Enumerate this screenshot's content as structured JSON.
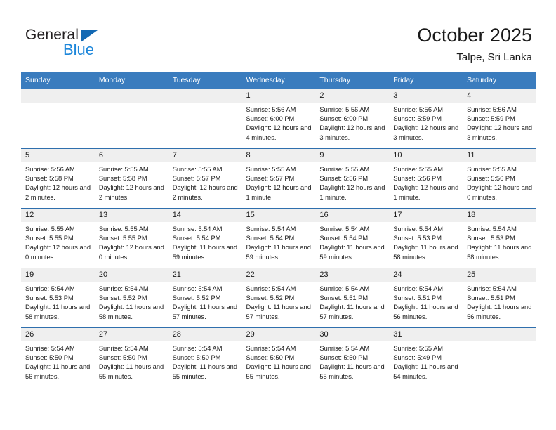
{
  "brand": {
    "name_top": "General",
    "name_bottom": "Blue",
    "accent_color": "#1268b3",
    "accent_color_light": "#1e87da"
  },
  "header": {
    "title": "October 2025",
    "subtitle": "Talpe, Sri Lanka"
  },
  "theme": {
    "header_row_bg": "#3a7cbe",
    "daynum_bg": "#efefef",
    "cell_border": "#2f6fad",
    "text": "#1a1a1a"
  },
  "calendar": {
    "weekdays": [
      "Sunday",
      "Monday",
      "Tuesday",
      "Wednesday",
      "Thursday",
      "Friday",
      "Saturday"
    ],
    "weeks": [
      [
        {
          "day": "",
          "empty": true
        },
        {
          "day": "",
          "empty": true
        },
        {
          "day": "",
          "empty": true
        },
        {
          "day": "1",
          "sunrise": "Sunrise: 5:56 AM",
          "sunset": "Sunset: 6:00 PM",
          "daylight": "Daylight: 12 hours and 4 minutes."
        },
        {
          "day": "2",
          "sunrise": "Sunrise: 5:56 AM",
          "sunset": "Sunset: 6:00 PM",
          "daylight": "Daylight: 12 hours and 3 minutes."
        },
        {
          "day": "3",
          "sunrise": "Sunrise: 5:56 AM",
          "sunset": "Sunset: 5:59 PM",
          "daylight": "Daylight: 12 hours and 3 minutes."
        },
        {
          "day": "4",
          "sunrise": "Sunrise: 5:56 AM",
          "sunset": "Sunset: 5:59 PM",
          "daylight": "Daylight: 12 hours and 3 minutes."
        }
      ],
      [
        {
          "day": "5",
          "sunrise": "Sunrise: 5:56 AM",
          "sunset": "Sunset: 5:58 PM",
          "daylight": "Daylight: 12 hours and 2 minutes."
        },
        {
          "day": "6",
          "sunrise": "Sunrise: 5:55 AM",
          "sunset": "Sunset: 5:58 PM",
          "daylight": "Daylight: 12 hours and 2 minutes."
        },
        {
          "day": "7",
          "sunrise": "Sunrise: 5:55 AM",
          "sunset": "Sunset: 5:57 PM",
          "daylight": "Daylight: 12 hours and 2 minutes."
        },
        {
          "day": "8",
          "sunrise": "Sunrise: 5:55 AM",
          "sunset": "Sunset: 5:57 PM",
          "daylight": "Daylight: 12 hours and 1 minute."
        },
        {
          "day": "9",
          "sunrise": "Sunrise: 5:55 AM",
          "sunset": "Sunset: 5:56 PM",
          "daylight": "Daylight: 12 hours and 1 minute."
        },
        {
          "day": "10",
          "sunrise": "Sunrise: 5:55 AM",
          "sunset": "Sunset: 5:56 PM",
          "daylight": "Daylight: 12 hours and 1 minute."
        },
        {
          "day": "11",
          "sunrise": "Sunrise: 5:55 AM",
          "sunset": "Sunset: 5:56 PM",
          "daylight": "Daylight: 12 hours and 0 minutes."
        }
      ],
      [
        {
          "day": "12",
          "sunrise": "Sunrise: 5:55 AM",
          "sunset": "Sunset: 5:55 PM",
          "daylight": "Daylight: 12 hours and 0 minutes."
        },
        {
          "day": "13",
          "sunrise": "Sunrise: 5:55 AM",
          "sunset": "Sunset: 5:55 PM",
          "daylight": "Daylight: 12 hours and 0 minutes."
        },
        {
          "day": "14",
          "sunrise": "Sunrise: 5:54 AM",
          "sunset": "Sunset: 5:54 PM",
          "daylight": "Daylight: 11 hours and 59 minutes."
        },
        {
          "day": "15",
          "sunrise": "Sunrise: 5:54 AM",
          "sunset": "Sunset: 5:54 PM",
          "daylight": "Daylight: 11 hours and 59 minutes."
        },
        {
          "day": "16",
          "sunrise": "Sunrise: 5:54 AM",
          "sunset": "Sunset: 5:54 PM",
          "daylight": "Daylight: 11 hours and 59 minutes."
        },
        {
          "day": "17",
          "sunrise": "Sunrise: 5:54 AM",
          "sunset": "Sunset: 5:53 PM",
          "daylight": "Daylight: 11 hours and 58 minutes."
        },
        {
          "day": "18",
          "sunrise": "Sunrise: 5:54 AM",
          "sunset": "Sunset: 5:53 PM",
          "daylight": "Daylight: 11 hours and 58 minutes."
        }
      ],
      [
        {
          "day": "19",
          "sunrise": "Sunrise: 5:54 AM",
          "sunset": "Sunset: 5:53 PM",
          "daylight": "Daylight: 11 hours and 58 minutes."
        },
        {
          "day": "20",
          "sunrise": "Sunrise: 5:54 AM",
          "sunset": "Sunset: 5:52 PM",
          "daylight": "Daylight: 11 hours and 58 minutes."
        },
        {
          "day": "21",
          "sunrise": "Sunrise: 5:54 AM",
          "sunset": "Sunset: 5:52 PM",
          "daylight": "Daylight: 11 hours and 57 minutes."
        },
        {
          "day": "22",
          "sunrise": "Sunrise: 5:54 AM",
          "sunset": "Sunset: 5:52 PM",
          "daylight": "Daylight: 11 hours and 57 minutes."
        },
        {
          "day": "23",
          "sunrise": "Sunrise: 5:54 AM",
          "sunset": "Sunset: 5:51 PM",
          "daylight": "Daylight: 11 hours and 57 minutes."
        },
        {
          "day": "24",
          "sunrise": "Sunrise: 5:54 AM",
          "sunset": "Sunset: 5:51 PM",
          "daylight": "Daylight: 11 hours and 56 minutes."
        },
        {
          "day": "25",
          "sunrise": "Sunrise: 5:54 AM",
          "sunset": "Sunset: 5:51 PM",
          "daylight": "Daylight: 11 hours and 56 minutes."
        }
      ],
      [
        {
          "day": "26",
          "sunrise": "Sunrise: 5:54 AM",
          "sunset": "Sunset: 5:50 PM",
          "daylight": "Daylight: 11 hours and 56 minutes."
        },
        {
          "day": "27",
          "sunrise": "Sunrise: 5:54 AM",
          "sunset": "Sunset: 5:50 PM",
          "daylight": "Daylight: 11 hours and 55 minutes."
        },
        {
          "day": "28",
          "sunrise": "Sunrise: 5:54 AM",
          "sunset": "Sunset: 5:50 PM",
          "daylight": "Daylight: 11 hours and 55 minutes."
        },
        {
          "day": "29",
          "sunrise": "Sunrise: 5:54 AM",
          "sunset": "Sunset: 5:50 PM",
          "daylight": "Daylight: 11 hours and 55 minutes."
        },
        {
          "day": "30",
          "sunrise": "Sunrise: 5:54 AM",
          "sunset": "Sunset: 5:50 PM",
          "daylight": "Daylight: 11 hours and 55 minutes."
        },
        {
          "day": "31",
          "sunrise": "Sunrise: 5:55 AM",
          "sunset": "Sunset: 5:49 PM",
          "daylight": "Daylight: 11 hours and 54 minutes."
        },
        {
          "day": "",
          "empty": true
        }
      ]
    ]
  }
}
